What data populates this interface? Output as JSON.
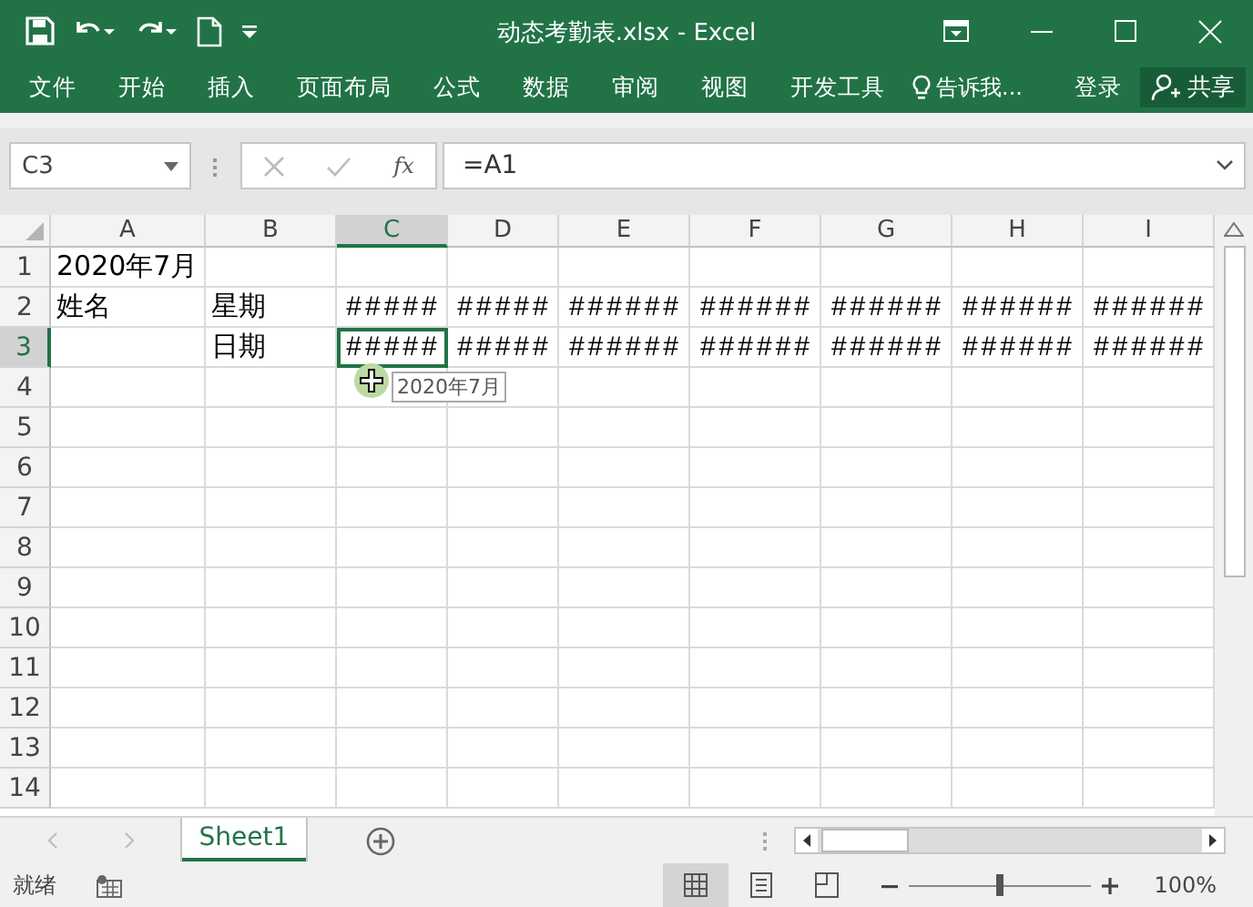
{
  "window": {
    "title": "动态考勤表.xlsx - Excel"
  },
  "quick_access": [
    {
      "kind": "save"
    },
    {
      "kind": "undo"
    },
    {
      "kind": "redo"
    },
    {
      "kind": "new"
    },
    {
      "kind": "customize"
    }
  ],
  "ribbon_tabs": [
    "文件",
    "开始",
    "插入",
    "页面布局",
    "公式",
    "数据",
    "审阅",
    "视图",
    "开发工具"
  ],
  "tell_me": "告诉我...",
  "sign_in": "登录",
  "share": "共享",
  "formula_bar": {
    "name_box": "C3",
    "fx": "fx",
    "formula": "=A1"
  },
  "columns": [
    {
      "label": "A",
      "selected": false
    },
    {
      "label": "B",
      "selected": false
    },
    {
      "label": "C",
      "selected": true
    },
    {
      "label": "D",
      "selected": false
    },
    {
      "label": "E",
      "selected": false
    },
    {
      "label": "F",
      "selected": false
    },
    {
      "label": "G",
      "selected": false
    },
    {
      "label": "H",
      "selected": false
    },
    {
      "label": "I",
      "selected": false
    }
  ],
  "rows": [
    {
      "label": "1",
      "selected": false,
      "cells": [
        {
          "text": "2020年7月",
          "selected": false
        }
      ]
    },
    {
      "label": "2",
      "selected": false,
      "cells": [
        {
          "text": "姓名",
          "selected": false
        },
        {
          "text": "星期",
          "selected": false
        },
        {
          "text": "#####",
          "selected": false
        },
        {
          "text": "#####",
          "selected": false
        },
        {
          "text": "######",
          "selected": false
        },
        {
          "text": "######",
          "selected": false
        },
        {
          "text": "######",
          "selected": false
        },
        {
          "text": "######",
          "selected": false
        },
        {
          "text": "######",
          "selected": false
        }
      ]
    },
    {
      "label": "3",
      "selected": true,
      "cells": [
        {
          "selected": false
        },
        {
          "text": "日期",
          "selected": false
        },
        {
          "text": "#####",
          "selected": true
        },
        {
          "text": "#####",
          "selected": false
        },
        {
          "text": "######",
          "selected": false
        },
        {
          "text": "######",
          "selected": false
        },
        {
          "text": "######",
          "selected": false
        },
        {
          "text": "######",
          "selected": false
        },
        {
          "text": "######",
          "selected": false
        }
      ]
    },
    {
      "label": "4",
      "selected": false,
      "cells": []
    },
    {
      "label": "5",
      "selected": false,
      "cells": []
    },
    {
      "label": "6",
      "selected": false,
      "cells": []
    },
    {
      "label": "7",
      "selected": false,
      "cells": []
    },
    {
      "label": "8",
      "selected": false,
      "cells": []
    },
    {
      "label": "9",
      "selected": false,
      "cells": []
    },
    {
      "label": "10",
      "selected": false,
      "cells": []
    },
    {
      "label": "11",
      "selected": false,
      "cells": []
    },
    {
      "label": "12",
      "selected": false,
      "cells": []
    },
    {
      "label": "13",
      "selected": false,
      "cells": []
    },
    {
      "label": "14",
      "selected": false,
      "cells": []
    }
  ],
  "tooltip": "2020年7月",
  "sheet_tabs": [
    {
      "label": "Sheet1",
      "selected": true
    }
  ],
  "status_bar": {
    "status": "就绪",
    "views": [
      {
        "kind": "normal",
        "selected": true
      },
      {
        "kind": "page-layout",
        "selected": false
      },
      {
        "kind": "page-break",
        "selected": false
      }
    ],
    "zoom": {
      "level": 0.5,
      "reading": "100%"
    }
  }
}
